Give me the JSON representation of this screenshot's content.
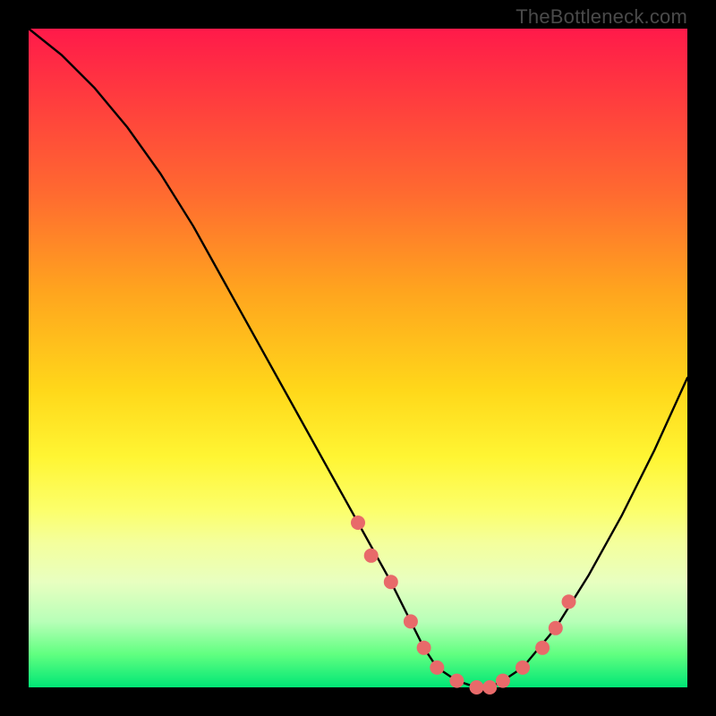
{
  "watermark": "TheBottleneck.com",
  "chart_data": {
    "type": "line",
    "title": "",
    "xlabel": "",
    "ylabel": "",
    "xlim": [
      0,
      100
    ],
    "ylim": [
      0,
      100
    ],
    "grid": false,
    "legend": false,
    "series": [
      {
        "name": "bottleneck-curve",
        "x": [
          0,
          5,
          10,
          15,
          20,
          25,
          30,
          35,
          40,
          45,
          50,
          55,
          58,
          60,
          62,
          65,
          68,
          70,
          72,
          75,
          80,
          85,
          90,
          95,
          100
        ],
        "y": [
          100,
          96,
          91,
          85,
          78,
          70,
          61,
          52,
          43,
          34,
          25,
          16,
          10,
          6,
          3,
          1,
          0,
          0,
          1,
          3,
          9,
          17,
          26,
          36,
          47
        ]
      }
    ],
    "markers": {
      "name": "highlight-points",
      "x": [
        50,
        52,
        55,
        58,
        60,
        62,
        65,
        68,
        70,
        72,
        75,
        78,
        80,
        82
      ],
      "y": [
        25,
        20,
        16,
        10,
        6,
        3,
        1,
        0,
        0,
        1,
        3,
        6,
        9,
        13
      ]
    },
    "colors": {
      "curve": "#000000",
      "markers": "#e86a6a",
      "gradient_top": "#ff1a4a",
      "gradient_bottom": "#00e676"
    }
  }
}
